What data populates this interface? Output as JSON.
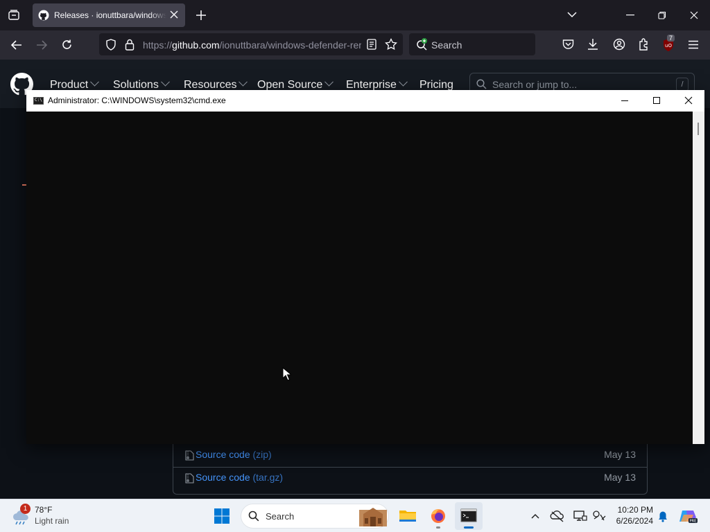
{
  "browser": {
    "tab_title": "Releases · ionuttbara/windows-defender-remover",
    "url_prefix": "https://",
    "url_host": "github.com",
    "url_path": "/ionuttbara/windows-defender-remover",
    "search_placeholder": "Search",
    "extension_badge": "7"
  },
  "github": {
    "nav": [
      "Product",
      "Solutions",
      "Resources",
      "Open Source",
      "Enterprise",
      "Pricing"
    ],
    "search_placeholder": "Search or jump to...",
    "search_shortcut": "/",
    "assets": [
      {
        "name": "Source code",
        "ext": "(zip)",
        "date": "May 13"
      },
      {
        "name": "Source code",
        "ext": "(tar.gz)",
        "date": "May 13"
      }
    ]
  },
  "cmd": {
    "title": "Administrator: C:\\WINDOWS\\system32\\cmd.exe"
  },
  "taskbar": {
    "weather_temp": "78°F",
    "weather_condition": "Light rain",
    "weather_badge": "1",
    "search_label": "Search",
    "time": "10:20 PM",
    "date": "6/26/2024"
  },
  "colors": {
    "github_bg": "#0d1117",
    "link": "#4493f8",
    "taskbar_accent": "#0067c0"
  }
}
